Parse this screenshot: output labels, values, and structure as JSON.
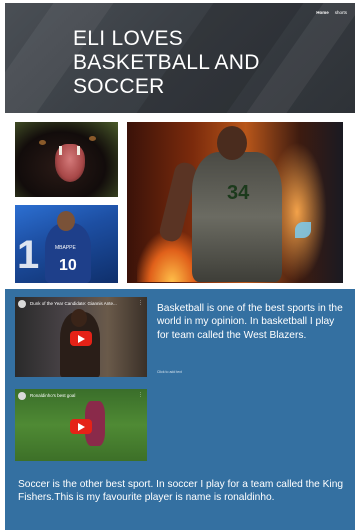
{
  "header": {
    "title": "ELI LOVES BASKETBALL AND SOCCER",
    "nav": [
      {
        "label": "Home",
        "active": true
      },
      {
        "label": "shorts",
        "active": false
      }
    ]
  },
  "gallery": {
    "soccer_jersey": {
      "name": "MBAPPE",
      "number": "10",
      "big_digit": "1"
    },
    "basketball_jersey": {
      "number": "34"
    }
  },
  "videos": [
    {
      "title": "Dunk of the Year Candidate: Giannis Ante...",
      "menu_icon": "more-vert-icon"
    },
    {
      "title": "Ronaldinho's best goal",
      "menu_icon": "more-vert-icon"
    }
  ],
  "content": {
    "basketball_text": "Basketball is one of the best sports in the world in my opinion. In basketball I play for team called the West Blazers.",
    "caption": "Click to add text",
    "soccer_text": "Soccer is the other best sport. In soccer I play for a team called the King Fishers.This is my favourite player is name is ronaldinho."
  },
  "colors": {
    "header_bg": "#3b4046",
    "section_bg": "#3470a1",
    "play_button": "#e52217",
    "text": "#ffffff"
  }
}
